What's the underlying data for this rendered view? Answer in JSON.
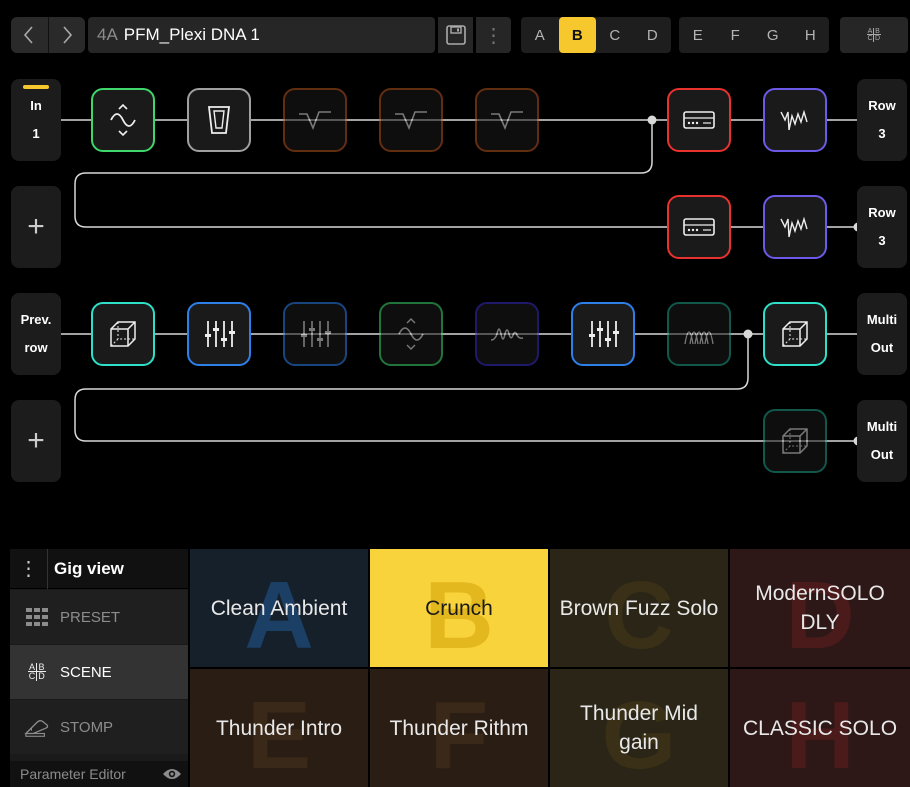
{
  "topbar": {
    "prev_icon": "chevron-left-icon",
    "next_icon": "chevron-right-icon",
    "preset_number": "4A",
    "preset_name": "PFM_Plexi DNA 1",
    "save_icon": "save-icon",
    "more_icon": "vertical-dots-icon",
    "more_glyph": "⋮",
    "scenes_left": [
      "A",
      "B",
      "C",
      "D"
    ],
    "scenes_right": [
      "E",
      "F",
      "G",
      "H"
    ],
    "active_scene": "B",
    "scene_view_icon": "abcd-grid-icon",
    "abcd": [
      "A",
      "B",
      "C",
      "D"
    ]
  },
  "grid": {
    "row1_in": [
      "In",
      "1"
    ],
    "row1_out": [
      "Row",
      "3"
    ],
    "row2_out": [
      "Row",
      "3"
    ],
    "row3_in": [
      "Prev.",
      "row"
    ],
    "row3_out": [
      "Multi",
      "Out"
    ],
    "row4_out": [
      "Multi",
      "Out"
    ],
    "add_glyph": "+",
    "colors": {
      "green": "#3fd66b",
      "gray": "#a0a0a0",
      "orange": "#b3541e",
      "red": "#e8322d",
      "purple": "#6b5ae8",
      "teal": "#2ee0c8",
      "blue": "#2f7fe8",
      "violet": "#3a2fc0",
      "darkteal": "#1f9f88",
      "yellow": "#f6c82e"
    }
  },
  "sidebar": {
    "more_glyph": "⋮",
    "title": "Gig view",
    "items": [
      {
        "label": "PRESET",
        "icon": "preset-grid-icon"
      },
      {
        "label": "SCENE",
        "icon": "abcd-grid-icon"
      },
      {
        "label": "STOMP",
        "icon": "stomp-pedal-icon"
      }
    ],
    "active": "SCENE",
    "footer": "Parameter Editor",
    "footer_icon": "eye-icon",
    "abcd": [
      "A",
      "B",
      "C",
      "D"
    ]
  },
  "scenes": [
    {
      "letter": "A",
      "name": "Clean Ambient",
      "bg": "#16202b",
      "letter_color": "#1c3f66",
      "text_color": "#e8e8e8"
    },
    {
      "letter": "B",
      "name": "Crunch",
      "bg": "#f9d33b",
      "letter_color": "#e3b81e",
      "text_color": "#1a1a1a"
    },
    {
      "letter": "C",
      "name": "Brown Fuzz Solo",
      "bg": "#2a2517",
      "letter_color": "#3a3017",
      "text_color": "#e8e8e8"
    },
    {
      "letter": "D",
      "name": "ModernSOLO DLY",
      "bg": "#2d1717",
      "letter_color": "#4b1b1b",
      "text_color": "#e8e8e8"
    },
    {
      "letter": "E",
      "name": "Thunder Intro",
      "bg": "#2a1d14",
      "letter_color": "#3a2818",
      "text_color": "#e8e8e8"
    },
    {
      "letter": "F",
      "name": "Thunder Rithm",
      "bg": "#2a1d14",
      "letter_color": "#3a2818",
      "text_color": "#e8e8e8"
    },
    {
      "letter": "G",
      "name": "Thunder Mid gain",
      "bg": "#2a2517",
      "letter_color": "#3a3017",
      "text_color": "#e8e8e8"
    },
    {
      "letter": "H",
      "name": "CLASSIC SOLO",
      "bg": "#2d1717",
      "letter_color": "#4b1b1b",
      "text_color": "#e8e8e8"
    }
  ]
}
